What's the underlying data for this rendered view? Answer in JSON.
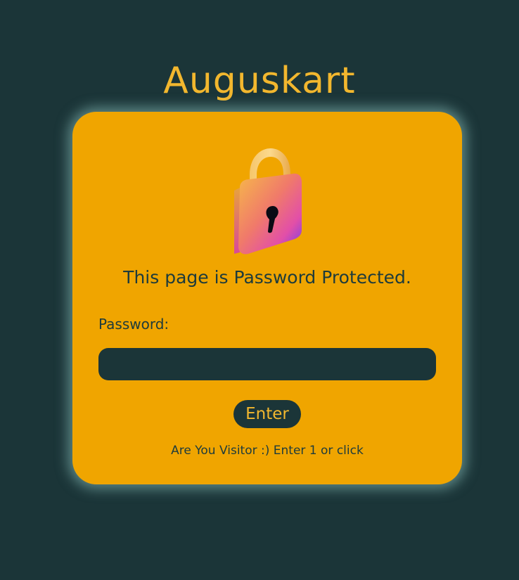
{
  "site": {
    "title": "Auguskart",
    "title_color": "#f2b72e",
    "background_color": "#1b3538"
  },
  "card": {
    "background_color": "#f0a500",
    "icon": "padlock-icon",
    "message": "This page is Password Protected."
  },
  "form": {
    "password_label": "Password:",
    "password_value": "",
    "password_placeholder": "",
    "enter_label": "Enter"
  },
  "visitor": {
    "text": "Are You Visitor :) Enter 1 or",
    "link_text": "click"
  }
}
